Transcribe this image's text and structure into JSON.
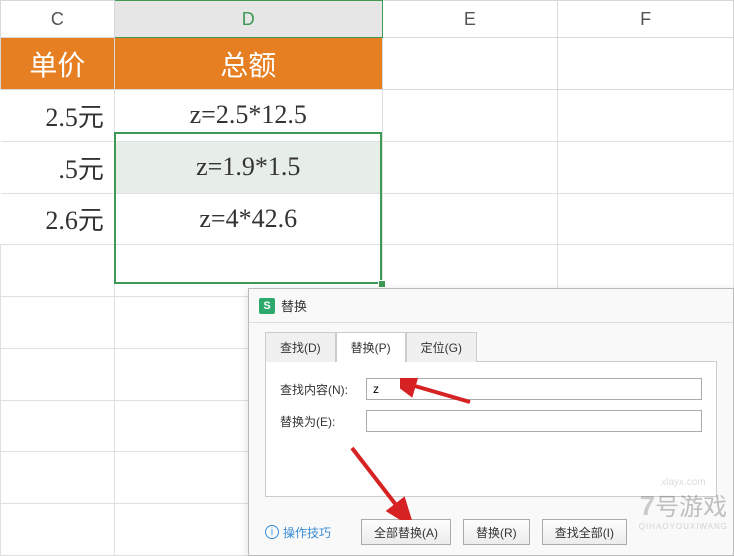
{
  "columns": {
    "c": "C",
    "d": "D",
    "e": "E",
    "f": "F"
  },
  "titles": {
    "c": "单价",
    "d": "总额"
  },
  "rows": [
    {
      "c": "2.5元",
      "d": "z=2.5*12.5"
    },
    {
      "c": ".5元",
      "d": "z=1.9*1.5"
    },
    {
      "c": "2.6元",
      "d": "z=4*42.6"
    }
  ],
  "dialog": {
    "title": "替换",
    "tabs": {
      "find": "查找(D)",
      "replace": "替换(P)",
      "goto": "定位(G)"
    },
    "labels": {
      "find_what": "查找内容(N):",
      "replace_with": "替换为(E):"
    },
    "values": {
      "find_what": "z",
      "replace_with": ""
    },
    "tips": "操作技巧",
    "buttons": {
      "replace_all": "全部替换(A)",
      "replace": "替换(R)",
      "find_all": "查找全部(I)"
    }
  },
  "watermark": {
    "num": "7",
    "cn": "号游戏",
    "py": "QIHAOYOUXIWANG",
    "url": "xlayx.com"
  }
}
